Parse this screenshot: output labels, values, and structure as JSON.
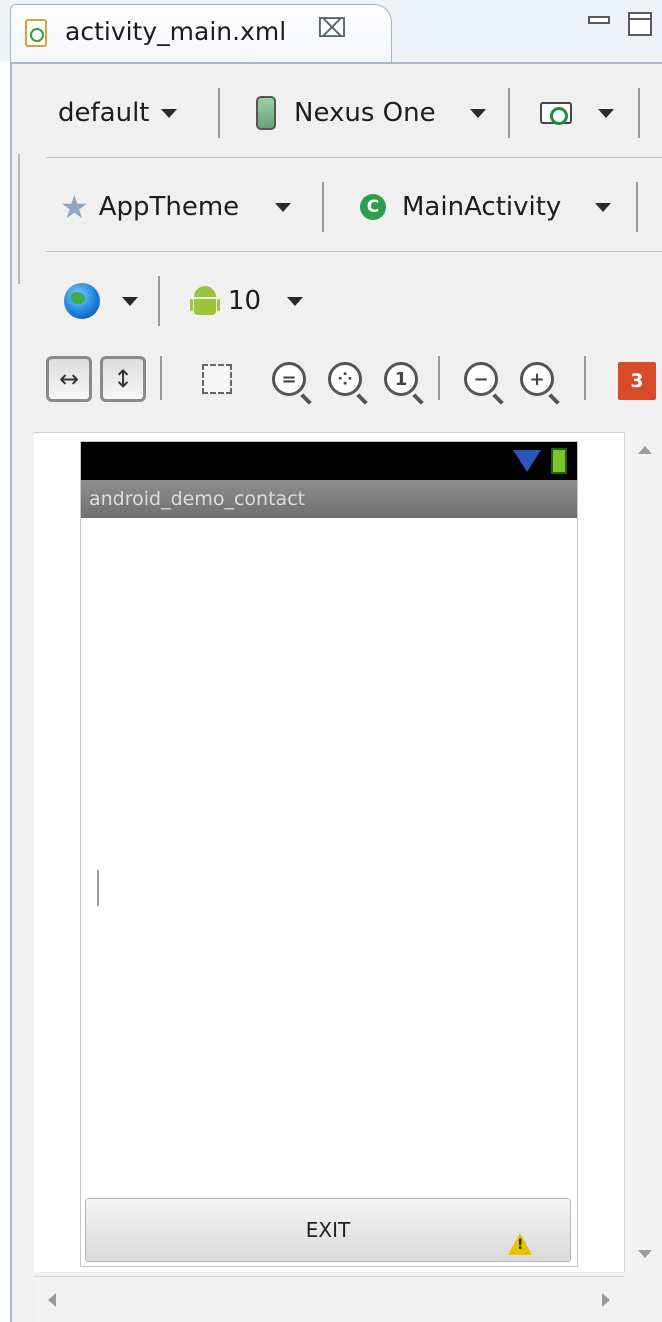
{
  "tab": {
    "title": "activity_main.xml",
    "close_glyph": "⌧",
    "icon": "xml-layout-file-icon"
  },
  "toolbar": {
    "config": "default",
    "device": "Nexus One",
    "theme": "AppTheme",
    "activity": "MainActivity",
    "api_level": "10",
    "error_count": "3"
  },
  "preview": {
    "app_title": "android_demo_contact",
    "exit_label": "EXIT"
  },
  "colors": {
    "error_badge": "#d84a2a",
    "android_green": "#9ac73a",
    "statusbar": "#000000"
  }
}
